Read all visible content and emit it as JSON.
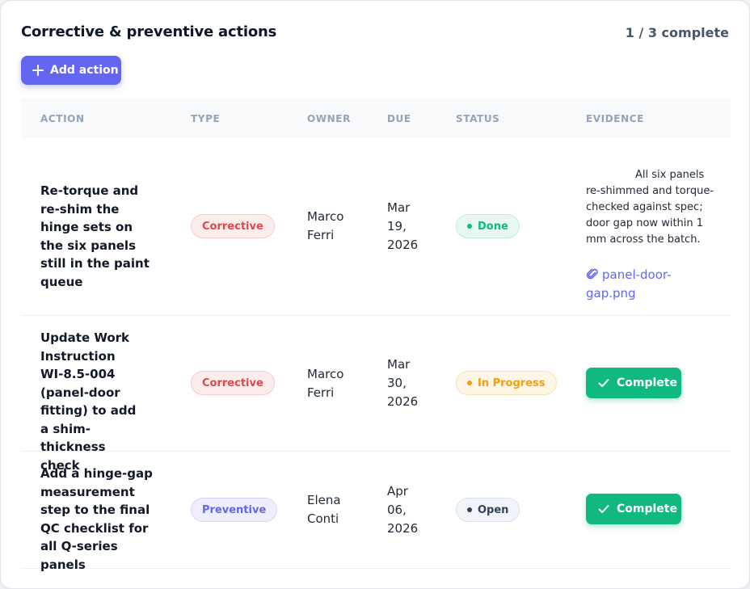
{
  "header": {
    "title": "Corrective & preventive actions",
    "counter": "1 / 3 complete",
    "add_label": "Add action"
  },
  "columns": [
    "ACTION",
    "TYPE",
    "OWNER",
    "DUE",
    "STATUS",
    "EVIDENCE"
  ],
  "rows": [
    {
      "action": "Re-torque and re-shim the hinge sets on the six panels still in the paint queue",
      "type": "Corrective",
      "owner": "Marco Ferri",
      "due": "Mar 19, 2026",
      "status": "Done",
      "evidence_note": "All six panels re-shimmed and torque-checked against spec; door gap now within 1 mm across the batch.",
      "evidence_file": "panel-door-gap.png"
    },
    {
      "action": "Update Work Instruction WI-8.5-004 (panel-door fitting) to add a shim-thickness check",
      "type": "Corrective",
      "owner": "Marco Ferri",
      "due": "Mar 30, 2026",
      "status": "In Progress",
      "evidence_button": "Complete"
    },
    {
      "action": "Add a hinge-gap measurement step to the final QC checklist for all Q-series panels",
      "type": "Preventive",
      "owner": "Elena Conti",
      "due": "Apr 06, 2026",
      "status": "Open",
      "evidence_button": "Complete"
    }
  ],
  "icons": {
    "add": "plus-icon",
    "attachment": "paperclip-icon",
    "complete": "check-icon",
    "status": "dot-icon"
  },
  "colors": {
    "accent": "#6366f1",
    "success": "#10b981",
    "warning": "#f59e0b",
    "danger": "#e0484b",
    "neutral": "#334155"
  }
}
